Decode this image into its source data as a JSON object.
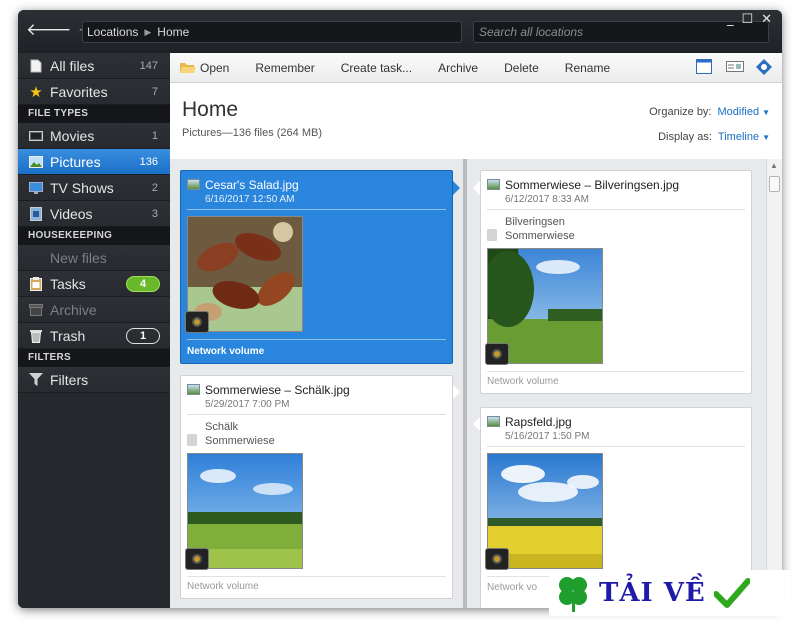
{
  "titlebar": {
    "back": "🡐",
    "forward": "🡒",
    "breadcrumb": [
      "Locations",
      "Home"
    ],
    "search_placeholder": "Search all locations",
    "controls": [
      "_",
      "☐",
      "✕"
    ]
  },
  "sidebar": {
    "top_items": [
      {
        "label": "All files",
        "count": "147",
        "icon": "document-icon"
      },
      {
        "label": "Favorites",
        "count": "7",
        "icon": "star-icon"
      }
    ],
    "file_types_header": "FILE TYPES",
    "file_types": [
      {
        "label": "Movies",
        "count": "1",
        "icon": "film-icon"
      },
      {
        "label": "Pictures",
        "count": "136",
        "icon": "picture-icon",
        "active": true
      },
      {
        "label": "TV Shows",
        "count": "2",
        "icon": "tv-icon"
      },
      {
        "label": "Videos",
        "count": "3",
        "icon": "video-icon"
      }
    ],
    "housekeeping_header": "HOUSEKEEPING",
    "housekeeping": [
      {
        "label": "New files",
        "disabled": true,
        "icon": "new-files-icon"
      },
      {
        "label": "Tasks",
        "badge": "4",
        "icon": "clipboard-icon"
      },
      {
        "label": "Archive",
        "disabled": true,
        "icon": "archive-icon"
      },
      {
        "label": "Trash",
        "badge": "1",
        "icon": "trash-icon"
      }
    ],
    "filters_header": "FILTERS",
    "filters": [
      {
        "label": "Filters",
        "icon": "funnel-icon"
      }
    ]
  },
  "toolbar": {
    "open": "Open",
    "remember": "Remember",
    "create_task": "Create task...",
    "archive": "Archive",
    "delete": "Delete",
    "rename": "Rename"
  },
  "main": {
    "title": "Home",
    "subtitle": "Pictures—136 files (264 MB)",
    "organize_label": "Organize by:",
    "organize_value": "Modified",
    "display_label": "Display as:",
    "display_value": "Timeline"
  },
  "cards": [
    {
      "name": "Cesar's Salad.jpg",
      "date": "6/16/2017 12:50 AM",
      "volume": "Network volume",
      "selected": true
    },
    {
      "name": "Sommerwiese – Schälk.jpg",
      "date": "5/29/2017 7:00 PM",
      "tags": [
        "Schälk",
        "Sommerwiese"
      ],
      "volume": "Network volume"
    },
    {
      "name": "Sommerwiese – Bilveringsen.jpg",
      "date": "6/12/2017 8:33 AM",
      "tags": [
        "Bilveringsen",
        "Sommerwiese"
      ],
      "volume": "Network volume"
    },
    {
      "name": "Rapsfeld.jpg",
      "date": "5/16/2017 1:50 PM",
      "volume": "Network vo"
    }
  ],
  "watermark": {
    "text": "TẢI VỀ"
  },
  "colors": {
    "accent": "#2a85dd",
    "sidebar_bg": "#25282c",
    "badge_green": "#6ab92a"
  }
}
